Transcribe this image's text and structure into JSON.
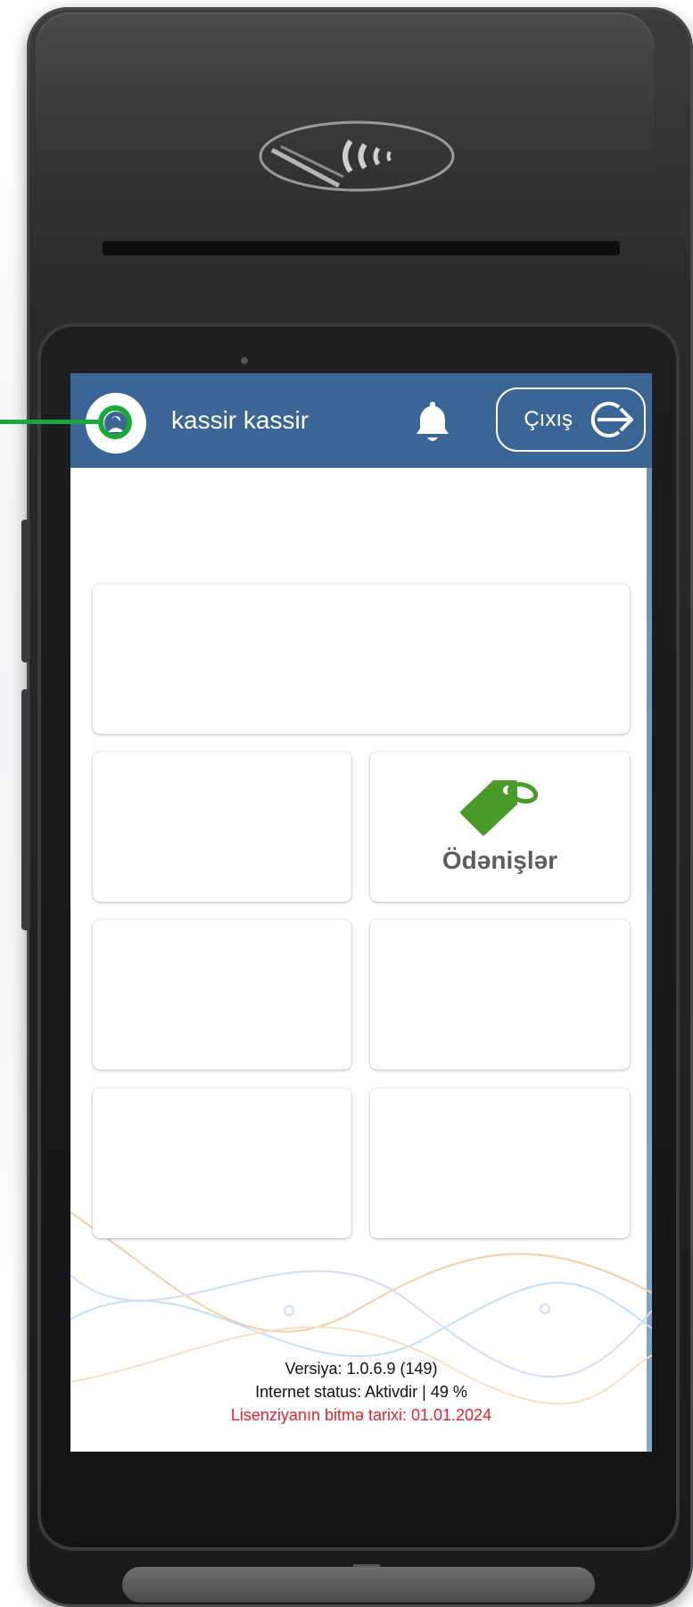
{
  "header": {
    "user_name": "kassir kassir",
    "logout_label": "Çıxış",
    "notification_icon": "bell-icon",
    "logout_icon": "logout-arrow-icon",
    "avatar_icon": "user-avatar-icon"
  },
  "tiles": [
    {
      "label": "",
      "icon": ""
    },
    {
      "label": "",
      "icon": ""
    },
    {
      "label": "Ödənişlər",
      "icon": "price-tag-icon"
    },
    {
      "label": "",
      "icon": ""
    },
    {
      "label": "",
      "icon": ""
    },
    {
      "label": "",
      "icon": ""
    },
    {
      "label": "",
      "icon": ""
    }
  ],
  "footer": {
    "version": "Versiya: 1.0.6.9 (149)",
    "internet_status": "Internet status: Aktivdir | 49 %",
    "license_expiry": "Lisenziyanın bitmə tarixi: 01.01.2024"
  },
  "colors": {
    "header_bg": "#3a6594",
    "accent_green": "#4a9a2a",
    "license_red": "#e0242f",
    "annotation_green": "#1aa83a"
  }
}
